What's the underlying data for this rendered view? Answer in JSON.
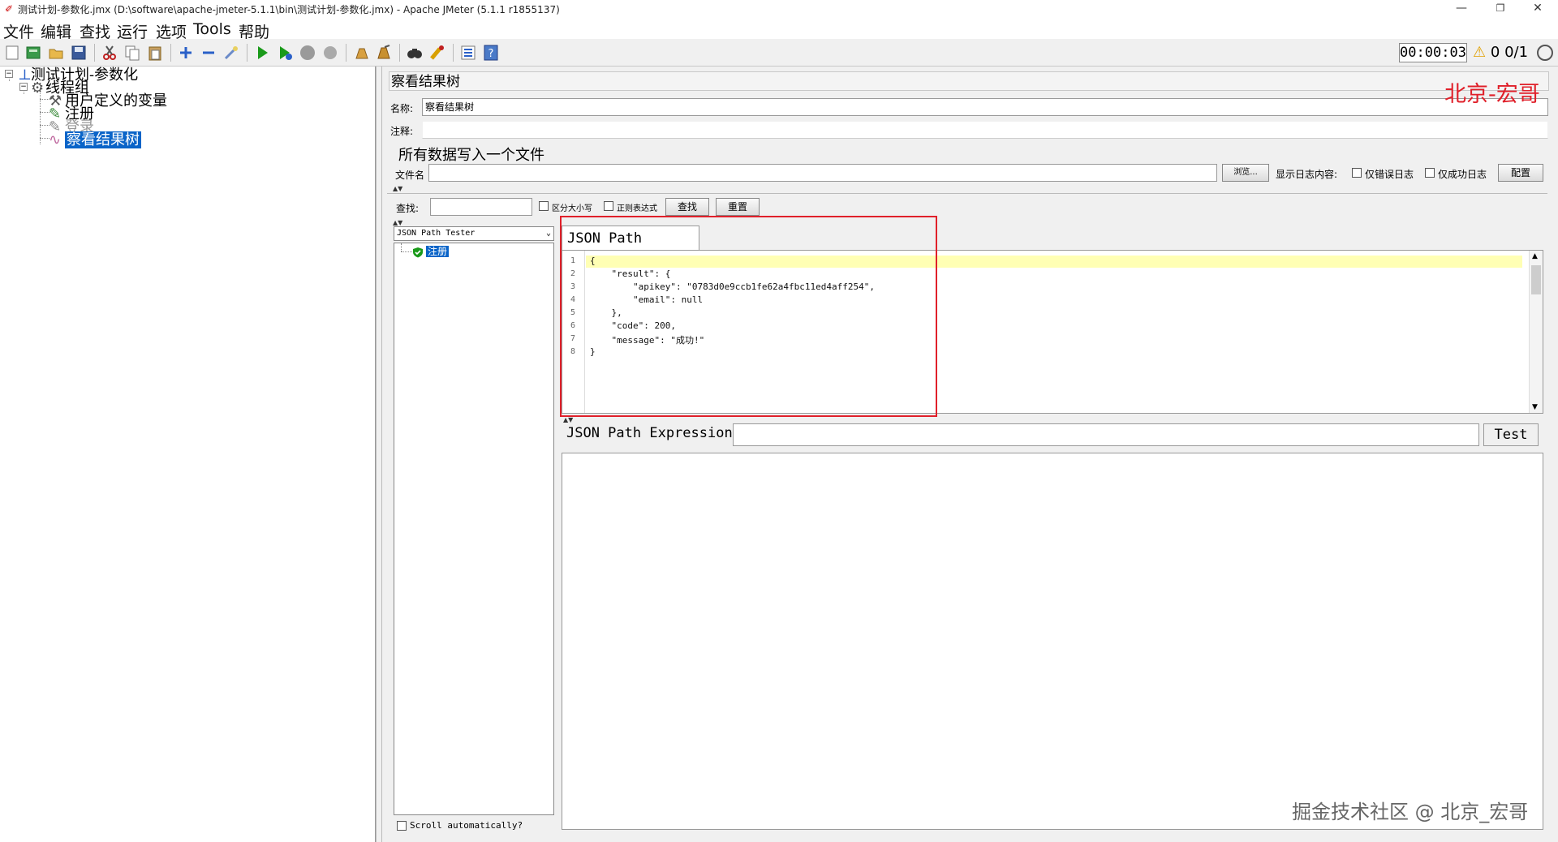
{
  "window": {
    "title": "测试计划-参数化.jmx (D:\\software\\apache-jmeter-5.1.1\\bin\\测试计划-参数化.jmx) - Apache JMeter (5.1.1 r1855137)",
    "minimize": "—",
    "restore": "❐",
    "close": "✕"
  },
  "menu": [
    "文件",
    "编辑",
    "查找",
    "运行",
    "选项",
    "Tools",
    "帮助"
  ],
  "toolbar": {
    "timer": "00:00:03",
    "warnings": "0",
    "threads": "0/1"
  },
  "tree": {
    "items": [
      {
        "label": "测试计划-参数化"
      },
      {
        "label": "线程组"
      },
      {
        "label": "用户定义的变量"
      },
      {
        "label": "注册"
      },
      {
        "label": "登录"
      },
      {
        "label": "察看结果树"
      }
    ]
  },
  "panel": {
    "title": "察看结果树",
    "name_label": "名称:",
    "name_value": "察看结果树",
    "comment_label": "注释:",
    "comment_value": "",
    "file_group_title": "所有数据写入一个文件",
    "filename_label": "文件名",
    "filename_value": "",
    "browse_button": "浏览...",
    "log_content_label": "显示日志内容:",
    "errors_only_label": "仅错误日志",
    "success_only_label": "仅成功日志",
    "configure_button": "配置",
    "search_label": "查找:",
    "search_value": "",
    "case_sensitive_label": "区分大小写",
    "regex_label": "正则表达式",
    "find_button": "查找",
    "reset_button": "重置"
  },
  "results": {
    "renderer": "JSON Path Tester",
    "samples": [
      {
        "label": "注册",
        "status": "success"
      }
    ],
    "scroll_auto_label": "Scroll automatically?"
  },
  "json_tester": {
    "tab_label": "JSON Path Tester",
    "lines": [
      "{",
      "    \"result\": {",
      "        \"apikey\": \"0783d0e9ccb1fe62a4fbc11ed4aff254\",",
      "        \"email\": null",
      "    },",
      "    \"code\": 200,",
      "    \"message\": \"成功!\"",
      "}"
    ],
    "line_numbers": [
      "1",
      "2",
      "3",
      "4",
      "5",
      "6",
      "7",
      "8"
    ],
    "expression_label": "JSON Path Expression",
    "expression_value": "",
    "test_button": "Test",
    "result_text": ""
  },
  "watermarks": {
    "top": "北京-宏哥",
    "bottom": "掘金技术社区 @ 北京_宏哥"
  },
  "colors": {
    "selection": "#0a64c8",
    "highlight_line": "#ffffb4",
    "annotation_red": "#e0202a",
    "run_green": "#1a9a1a"
  }
}
